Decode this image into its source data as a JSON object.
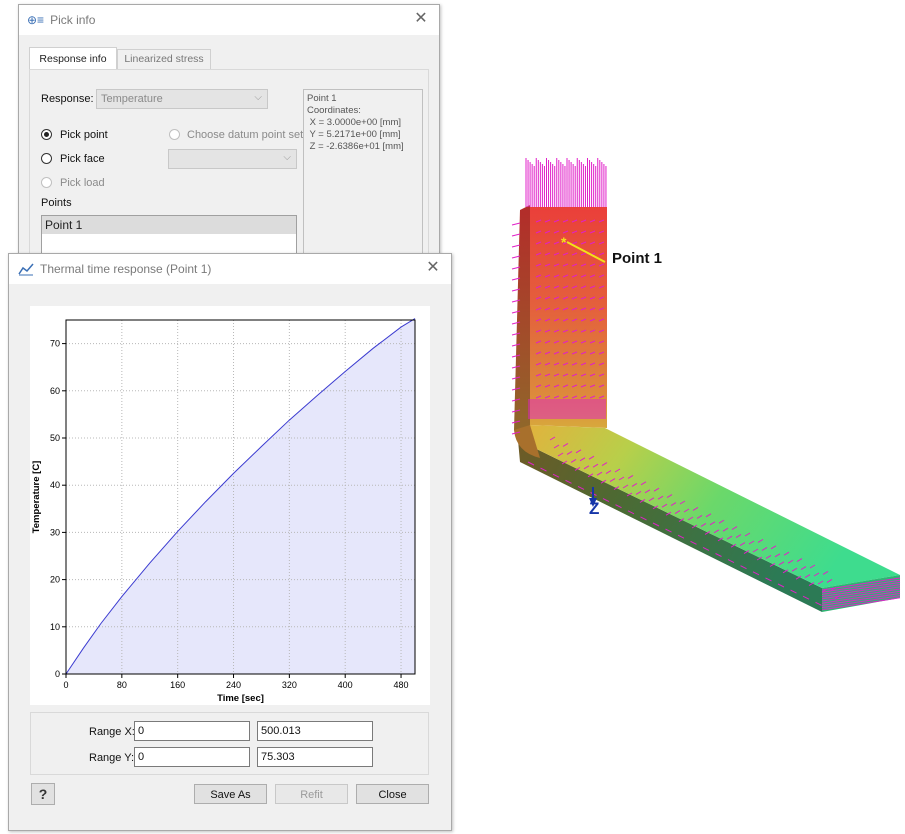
{
  "pick_info": {
    "title": "Pick info",
    "tabs": [
      {
        "label": "Response info",
        "active": true
      },
      {
        "label": "Linearized stress",
        "active": false
      }
    ],
    "response_label": "Response:",
    "response_value": "Temperature",
    "radios": {
      "pick_point": "Pick point",
      "choose_datum": "Choose datum point set",
      "pick_face": "Pick face",
      "pick_load": "Pick load"
    },
    "points_label": "Points",
    "points": [
      "Point 1"
    ],
    "info_panel": [
      "Point 1",
      "Coordinates:",
      " X = 3.0000e+00 [mm]",
      " Y = 5.2171e+00 [mm]",
      " Z = -2.6386e+01 [mm]"
    ]
  },
  "thermal": {
    "title": "Thermal time response  (Point 1)",
    "range_x_label": "Range X:",
    "range_x_min": "0",
    "range_x_max": "500.013",
    "range_y_label": "Range Y:",
    "range_y_min": "0",
    "range_y_max": "75.303",
    "help_label": "?",
    "save_as": "Save As",
    "refit": "Refit",
    "close": "Close"
  },
  "chart_data": {
    "type": "area",
    "xlabel": "Time [sec]",
    "ylabel": "Temperature [C]",
    "xlim": [
      0,
      500
    ],
    "ylim": [
      0,
      75
    ],
    "xticks": [
      0,
      80,
      160,
      240,
      320,
      400,
      480
    ],
    "yticks": [
      0,
      10,
      20,
      30,
      40,
      50,
      60,
      70
    ],
    "grid": true,
    "series": [
      {
        "x": [
          0,
          25,
          50,
          80,
          120,
          160,
          200,
          240,
          280,
          320,
          360,
          400,
          440,
          480,
          500
        ],
        "y": [
          0,
          5.5,
          10.7,
          16.4,
          23.5,
          30.2,
          36.5,
          42.5,
          48.2,
          53.8,
          59.0,
          64.1,
          69.0,
          73.5,
          75.3
        ]
      }
    ],
    "line_color": "#3b3bd0",
    "fill_color": "#e6e7fb"
  },
  "viewport": {
    "point_label": "Point 1",
    "axis_label": "Z",
    "arrow_color": "#e020c8"
  }
}
